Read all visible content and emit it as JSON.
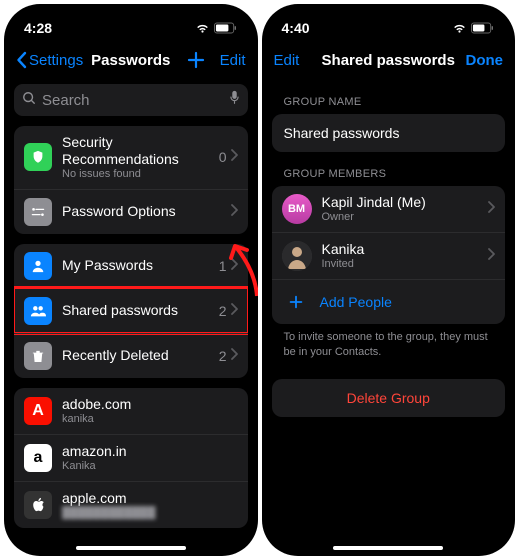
{
  "left": {
    "time": "4:28",
    "nav": {
      "back": "Settings",
      "title": "Passwords",
      "edit": "Edit"
    },
    "search_placeholder": "Search",
    "rec": {
      "label": "Security Recommendations",
      "sub": "No issues found",
      "count": "0"
    },
    "pwopts": "Password Options",
    "mypw": {
      "label": "My Passwords",
      "count": "1"
    },
    "shared": {
      "label": "Shared passwords",
      "count": "2"
    },
    "deleted": {
      "label": "Recently Deleted",
      "count": "2"
    },
    "sites": {
      "adobe": {
        "label": "adobe.com",
        "sub": "kanika"
      },
      "amazon": {
        "label": "amazon.in",
        "sub": "Kanika"
      },
      "apple": {
        "label": "apple.com"
      }
    }
  },
  "right": {
    "time": "4:40",
    "nav": {
      "edit": "Edit",
      "title": "Shared passwords",
      "done": "Done"
    },
    "group_name_hdr": "GROUP NAME",
    "group_name": "Shared passwords",
    "members_hdr": "GROUP MEMBERS",
    "owner": {
      "name": "Kapil Jindal (Me)",
      "role": "Owner",
      "initials": "BM"
    },
    "member": {
      "name": "Kanika",
      "role": "Invited"
    },
    "add": "Add People",
    "hint": "To invite someone to the group, they must be in your Contacts.",
    "delete": "Delete Group"
  }
}
